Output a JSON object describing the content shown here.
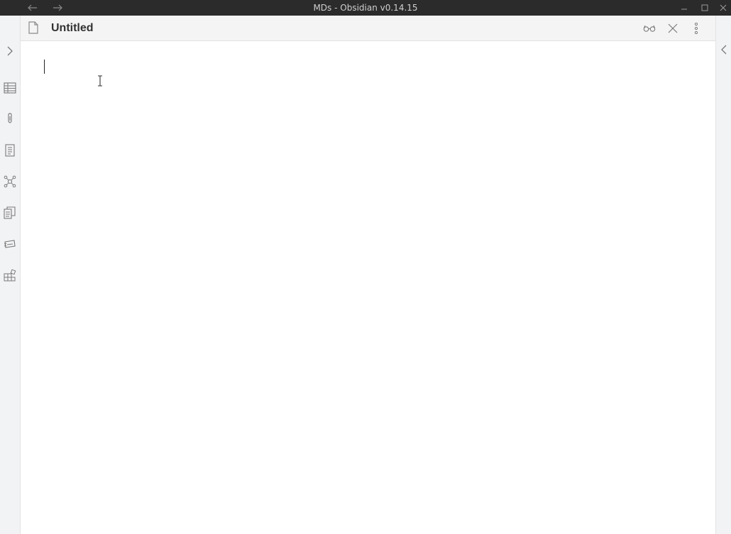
{
  "window": {
    "title": "MDs - Obsidian v0.14.15",
    "back_icon": "arrow-left-icon",
    "forward_icon": "arrow-right-icon",
    "controls": [
      "minimize-icon",
      "maximize-icon",
      "close-icon"
    ]
  },
  "left_ribbon": {
    "collapse_icon": "chevron-right-icon",
    "items": [
      "table-icon",
      "pin-icon",
      "document-list-icon",
      "graph-icon",
      "copy-files-icon",
      "cards-icon",
      "plugins-grid-icon"
    ]
  },
  "right_ribbon": {
    "collapse_icon": "chevron-left-icon"
  },
  "tab": {
    "file_icon": "file-icon",
    "title": "Untitled",
    "actions": [
      "reading-view-icon",
      "close-icon",
      "more-options-icon"
    ]
  },
  "editor": {
    "content": ""
  },
  "colors": {
    "titlebar": "#2b2b2b",
    "ribbon": "#f2f3f5",
    "header": "#f4f4f5",
    "icon": "#8a8a8a"
  }
}
